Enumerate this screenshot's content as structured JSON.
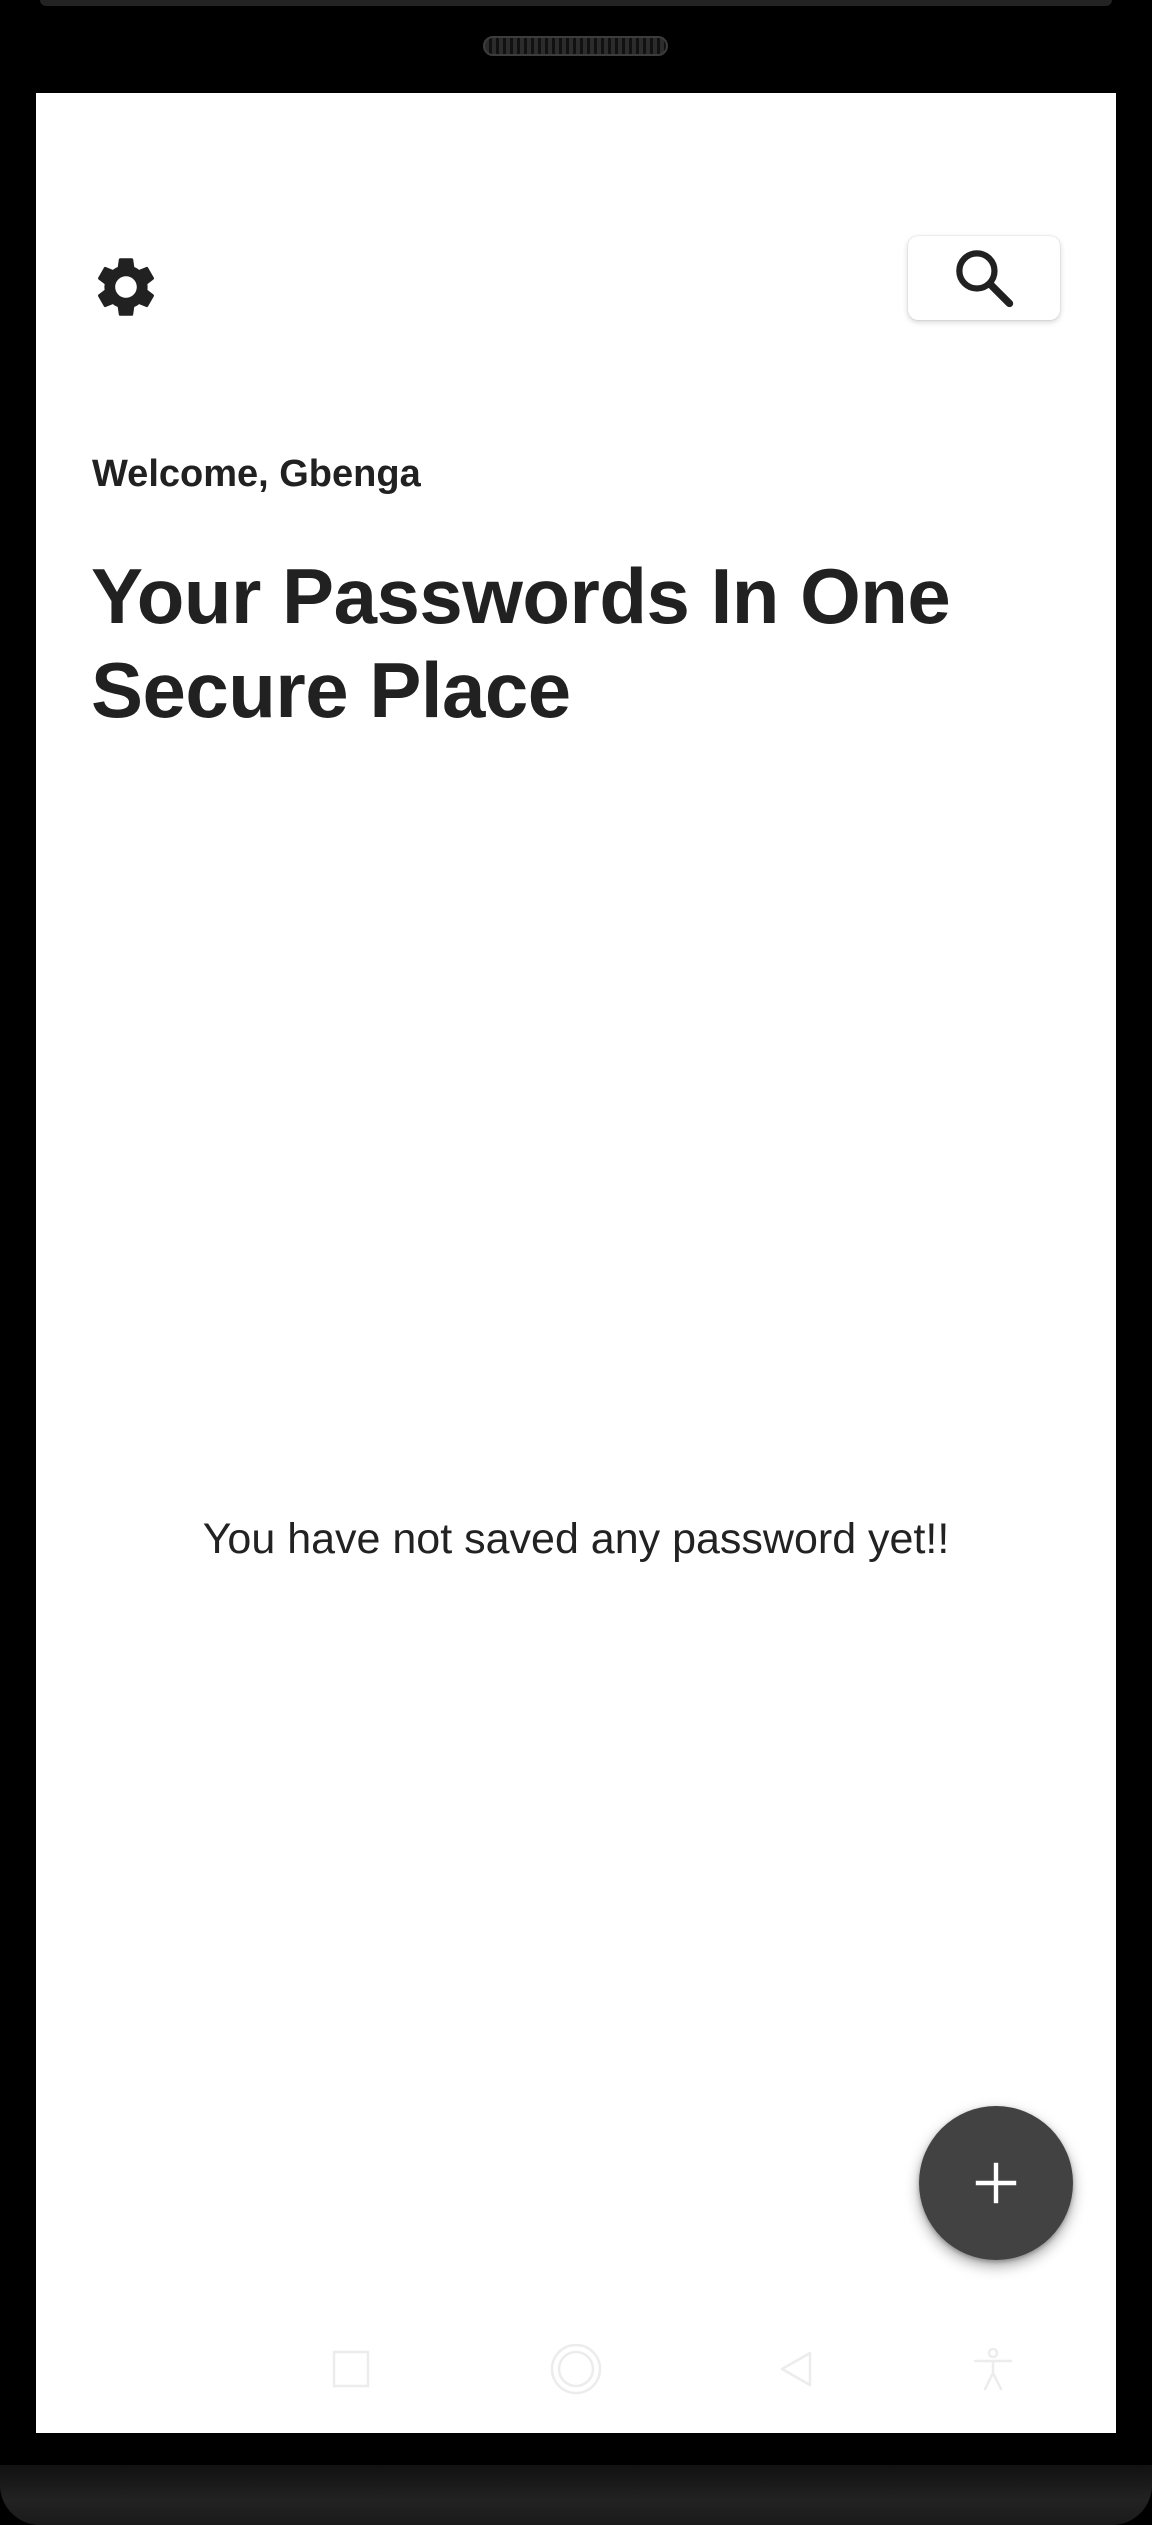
{
  "header": {
    "settings_icon": "gear-icon",
    "search_icon": "search-icon"
  },
  "greeting": "Welcome, Gbenga",
  "headline": "Your Passwords In One Secure Place",
  "empty_state": "You have not saved any password yet!!",
  "fab": {
    "icon": "plus-icon"
  },
  "nav": {
    "icons": [
      "square-icon",
      "circle-icon",
      "back-triangle-icon",
      "accessibility-icon"
    ]
  },
  "colors": {
    "text": "#212121",
    "fab": "#424242",
    "background": "#ffffff"
  }
}
